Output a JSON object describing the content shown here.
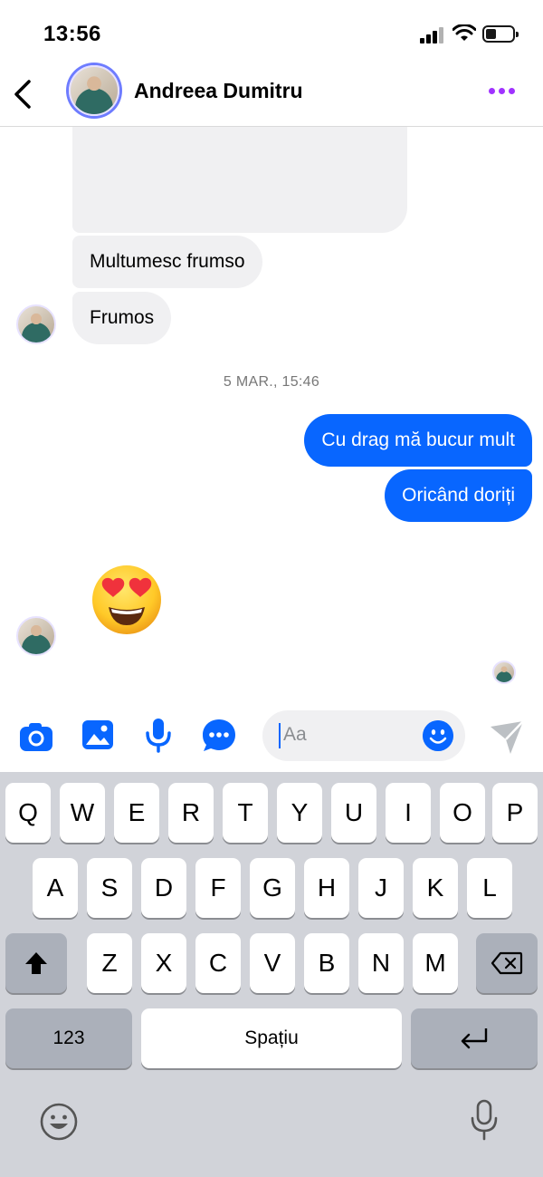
{
  "status_bar": {
    "time": "13:56"
  },
  "header": {
    "contact_name": "Andreea Dumitru",
    "back_icon": "chevron-left-icon",
    "more_icon": "more-dots-icon"
  },
  "messages": [
    {
      "direction": "in",
      "text": "Multumesc frumso"
    },
    {
      "direction": "in",
      "text": "Frumos"
    },
    {
      "direction": "out",
      "text": "Cu drag mă bucur mult"
    },
    {
      "direction": "out",
      "text": "Oricând doriți"
    },
    {
      "direction": "in",
      "emoji": "heart-eyes-emoji"
    }
  ],
  "timestamp": "5 MAR., 15:46",
  "composer": {
    "placeholder": "Aa"
  },
  "keyboard": {
    "row1": [
      "Q",
      "W",
      "E",
      "R",
      "T",
      "Y",
      "U",
      "I",
      "O",
      "P"
    ],
    "row2": [
      "A",
      "S",
      "D",
      "F",
      "G",
      "H",
      "J",
      "K",
      "L"
    ],
    "row3": [
      "Z",
      "X",
      "C",
      "V",
      "B",
      "N",
      "M"
    ],
    "numbers_label": "123",
    "space_label": "Spațiu"
  },
  "colors": {
    "accent": "#0866ff",
    "more_purple": "#a033ff",
    "incoming_bubble": "#f0f0f2",
    "keyboard_bg": "#d1d3d9"
  }
}
